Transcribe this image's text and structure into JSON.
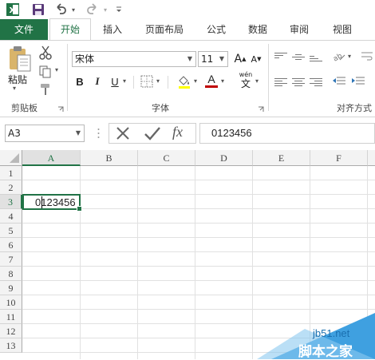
{
  "quick_access": {
    "app_icon": "excel-logo-icon",
    "save_icon": "save-icon",
    "undo_icon": "undo-icon",
    "redo_icon": "redo-icon",
    "customize_icon": "customize-qat-icon"
  },
  "tabs": [
    {
      "label": "文件"
    },
    {
      "label": "开始"
    },
    {
      "label": "插入"
    },
    {
      "label": "页面布局"
    },
    {
      "label": "公式"
    },
    {
      "label": "数据"
    },
    {
      "label": "审阅"
    },
    {
      "label": "视图"
    }
  ],
  "ribbon": {
    "clipboard": {
      "paste_label": "粘贴",
      "group_label": "剪贴板"
    },
    "font": {
      "font_name": "宋体",
      "font_size": "11",
      "grow_label": "A",
      "shrink_label": "A",
      "bold": "B",
      "italic": "I",
      "underline": "U",
      "phonetic_top": "wén",
      "phonetic_bottom": "文",
      "font_color_label": "A",
      "group_label": "字体"
    },
    "alignment": {
      "group_label": "对齐方式"
    }
  },
  "formula_bar": {
    "name_box": "A3",
    "fx_label": "fx",
    "value": "0123456"
  },
  "sheet": {
    "columns": [
      "A",
      "B",
      "C",
      "D",
      "E",
      "F"
    ],
    "rows": [
      "1",
      "2",
      "3",
      "4",
      "5",
      "6",
      "7",
      "8",
      "9",
      "10",
      "11",
      "12",
      "13"
    ],
    "active_cell": "A3",
    "cells": {
      "A3": "0123456"
    }
  },
  "watermark": {
    "line1": "jb51.net",
    "line2": "脚本之家"
  },
  "colors": {
    "excel_green": "#217346",
    "font_color_red": "#c00000"
  }
}
